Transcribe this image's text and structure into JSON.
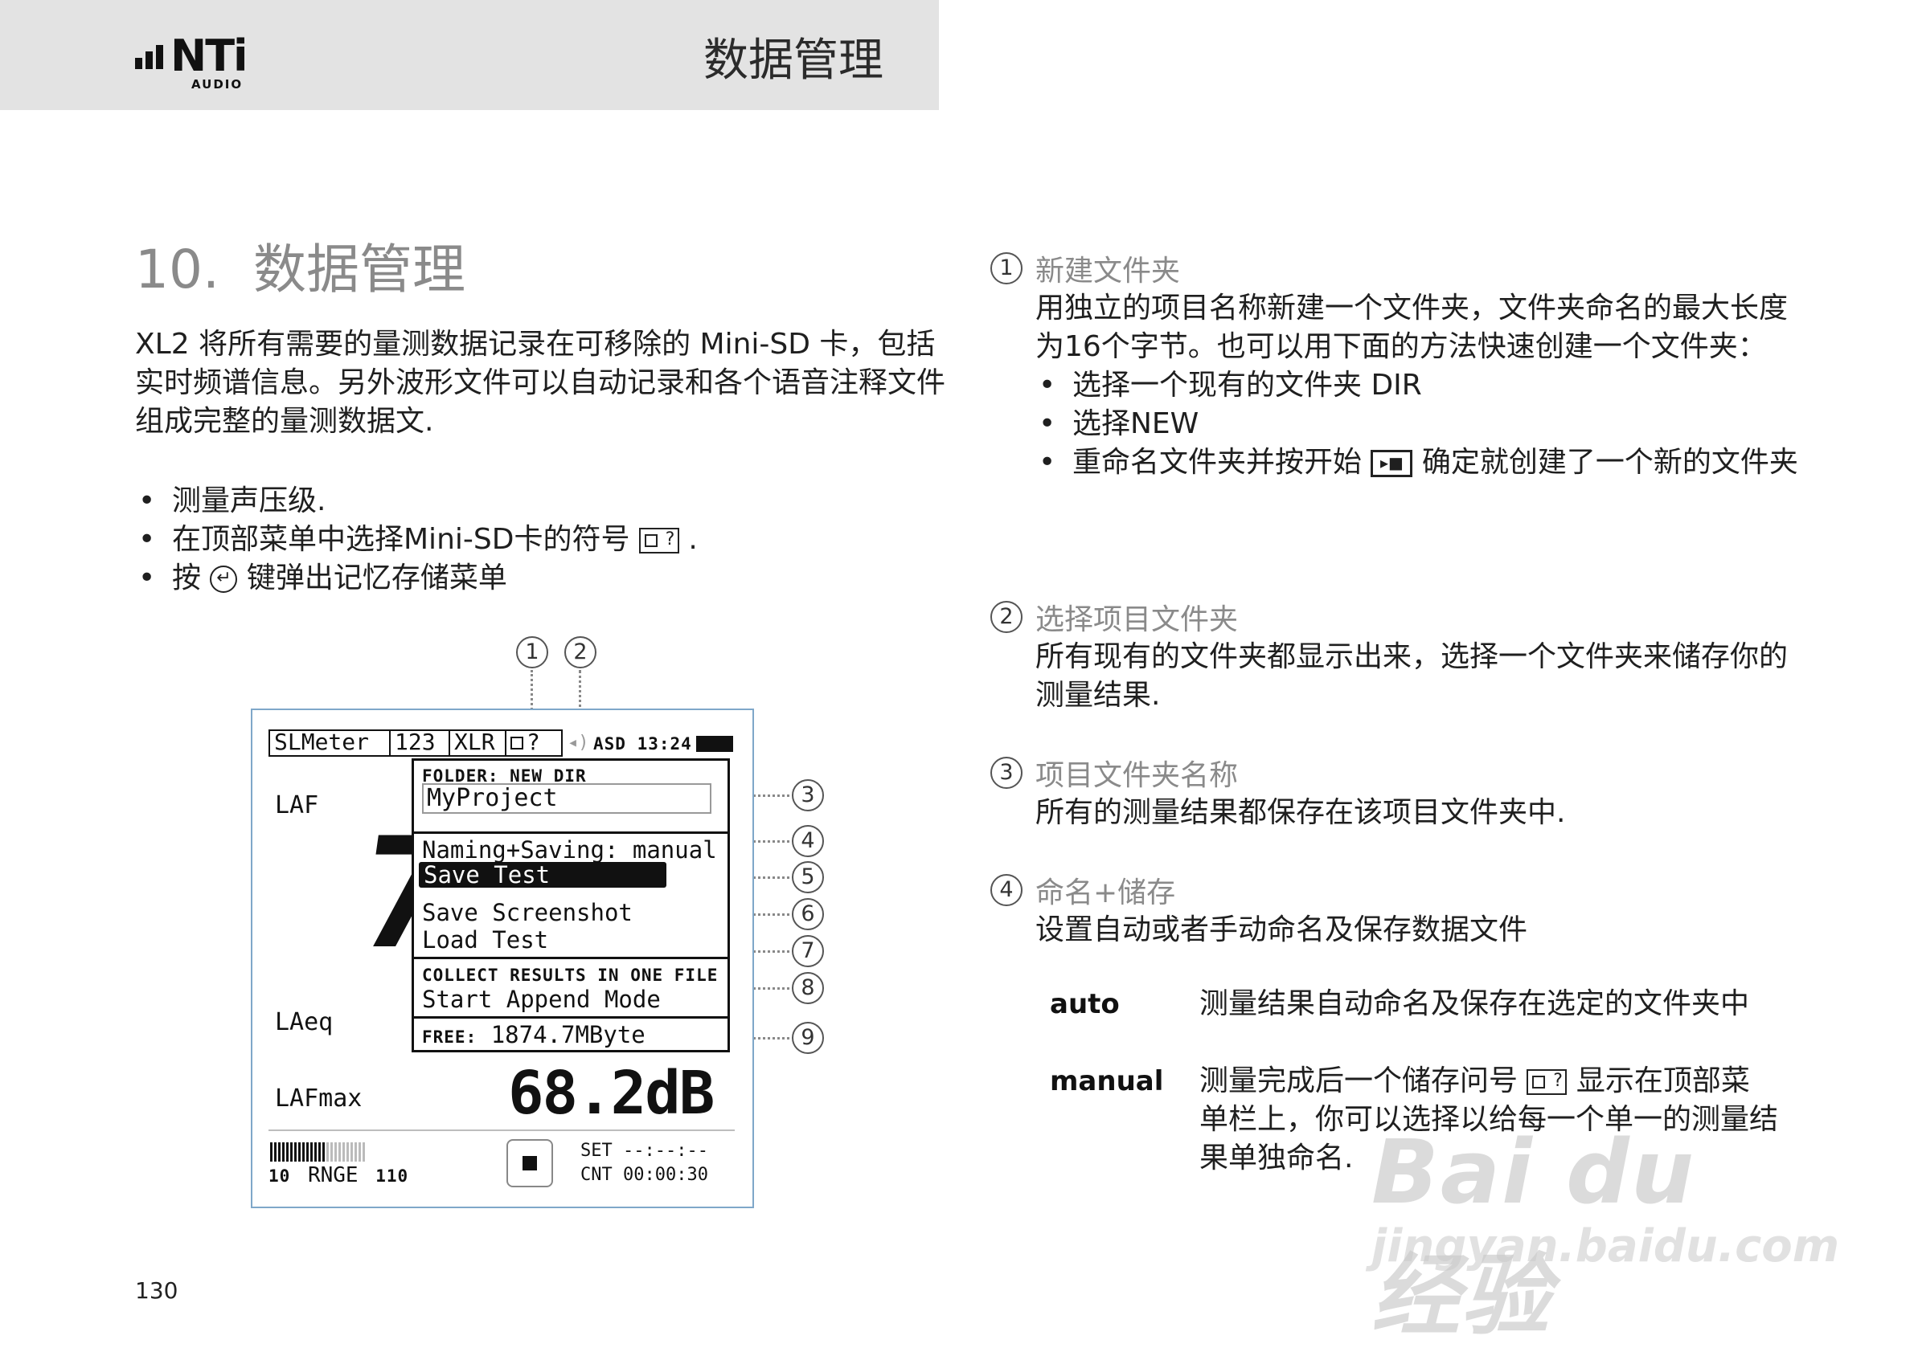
{
  "header": {
    "logo_text": "NTi",
    "logo_sub": "AUDIO",
    "title": "数据管理"
  },
  "section": {
    "number": "10.",
    "title": "数据管理"
  },
  "intro": "XL2 将所有需要的量测数据记录在可移除的 Mini-SD 卡，包括实时频谱信息。另外波形文件可以自动记录和各个语音注释文件组成完整的量测数据文.",
  "left_bullets": [
    "测量声压级.",
    "在顶部菜单中选择Mini-SD卡的符号",
    "按",
    "键弹出记忆存储菜单"
  ],
  "left_bullet_2_end": ".",
  "icons": {
    "sd_card": "sd-card-icon",
    "enter": "enter-key-icon",
    "play": "start-play-icon",
    "stop": "stop-icon"
  },
  "callouts": [
    "1",
    "2",
    "3",
    "4",
    "5",
    "6",
    "7",
    "8",
    "9"
  ],
  "device": {
    "topbar": {
      "tab_mode": "SLMeter",
      "tab_123": "123",
      "tab_xlr": "XLR",
      "tab_card_q": "?",
      "status": "ASD 13:24"
    },
    "label_laf": "LAF",
    "label_laeq": "LAeq",
    "label_lafmax": "LAFmax",
    "big_digit": "7",
    "lafmax_value": "68.2dB",
    "range_low": "10",
    "range_label": "RNGE",
    "range_high": "110",
    "set_line": "SET --:--:--",
    "cnt_line": "CNT 00:00:30",
    "menu": {
      "folder_label": "FOLDER: NEW DIR",
      "folder_value": "MyProject",
      "naming": "Naming+Saving: manual",
      "save_test": "Save Test",
      "save_screenshot": "Save Screenshot",
      "load_test": "Load Test",
      "collect_label": "COLLECT RESULTS IN ONE FILE",
      "start_append": "Start Append Mode",
      "free_label": "FREE:",
      "free_value": "1874.7MByte"
    }
  },
  "right": {
    "item1": {
      "num": "1",
      "title": "新建文件夹",
      "body": "用独立的项目名称新建一个文件夹，文件夹命名的最大长度为16个字节。也可以用下面的方法快速创建一个文件夹：",
      "bullets": [
        "选择一个现有的文件夹 DIR",
        "选择NEW",
        "重命名文件夹并按开始",
        "确定就创建了一个新的文件夹"
      ]
    },
    "item2": {
      "num": "2",
      "title": "选择项目文件夹",
      "body": "所有现有的文件夹都显示出来，选择一个文件夹来储存你的测量结果."
    },
    "item3": {
      "num": "3",
      "title": "项目文件夹名称",
      "body": "所有的测量结果都保存在该项目文件夹中."
    },
    "item4": {
      "num": "4",
      "title": "命名+储存",
      "body": "设置自动或者手动命名及保存数据文件"
    },
    "options": {
      "auto_label": "auto",
      "auto_desc": "测量结果自动命名及保存在选定的文件夹中",
      "manual_label": "manual",
      "manual_desc_a": "测量完成后一个储存问号",
      "manual_desc_b": "显示在顶部菜单栏上，你可以选择以给每一个单一的测量结果单独命名."
    }
  },
  "page_number": "130",
  "watermark": {
    "main": "Bai du 经验",
    "url": "jingyan.baidu.com"
  }
}
